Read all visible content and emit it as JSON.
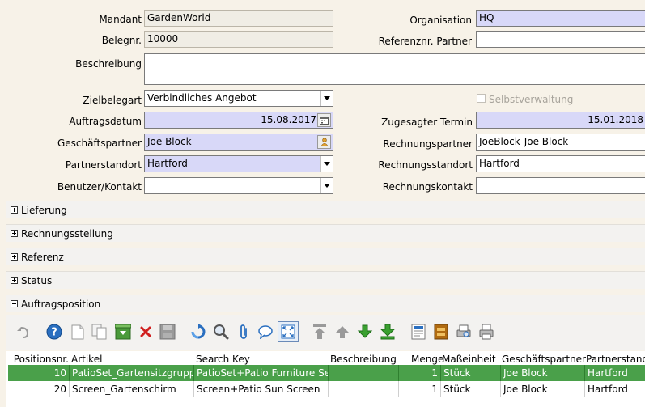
{
  "form": {
    "mandant": {
      "label": "Mandant",
      "value": "GardenWorld"
    },
    "organisation": {
      "label": "Organisation",
      "value": "HQ"
    },
    "belegnr": {
      "label": "Belegnr.",
      "value": "10000"
    },
    "referenznr": {
      "label": "Referenznr. Partner",
      "value": ""
    },
    "beschreibung": {
      "label": "Beschreibung",
      "value": ""
    },
    "zielbelegart": {
      "label": "Zielbelegart",
      "value": "Verbindliches Angebot"
    },
    "selbstverwaltung": {
      "label": "Selbstverwaltung",
      "checked": false
    },
    "auftragsdatum": {
      "label": "Auftragsdatum",
      "value": "15.08.2017"
    },
    "zugesagter_termin": {
      "label": "Zugesagter Termin",
      "value": "15.01.2018"
    },
    "geschaeftspartner": {
      "label": "Geschäftspartner",
      "value": "Joe Block"
    },
    "rechnungspartner": {
      "label": "Rechnungspartner",
      "value": "JoeBlock-Joe Block"
    },
    "partnerstandort": {
      "label": "Partnerstandort",
      "value": "Hartford"
    },
    "rechnungsstandort": {
      "label": "Rechnungsstandort",
      "value": "Hartford"
    },
    "benutzer": {
      "label": "Benutzer/Kontakt",
      "value": ""
    },
    "rechnungskontakt": {
      "label": "Rechnungskontakt",
      "value": ""
    }
  },
  "sections": [
    "Lieferung",
    "Rechnungsstellung",
    "Referenz",
    "Status",
    "Auftragsposition"
  ],
  "toolbar": {
    "icons": [
      "undo-icon",
      "help-icon",
      "new-record-icon",
      "copy-record-icon",
      "delete-selection-icon",
      "delete-icon",
      "save-icon",
      "refresh-icon",
      "find-icon",
      "attachment-icon",
      "chat-icon",
      "zoom-grid-icon",
      "parent-record-icon",
      "previous-record-icon",
      "next-record-icon",
      "last-record-icon",
      "report-icon",
      "archive-icon",
      "print-preview-icon",
      "print-icon"
    ]
  },
  "grid": {
    "headers": [
      "Positionsnr.",
      "Artikel",
      "Search Key",
      "Beschreibung",
      "Menge",
      "Maßeinheit",
      "Geschäftspartner",
      "Partnerstandort"
    ],
    "rows": [
      {
        "pos": "10",
        "artikel": "PatioSet_Gartensitzgruppe",
        "key": "PatioSet+Patio Furniture Set",
        "beschreibung": "",
        "menge": "1",
        "einheit": "Stück",
        "partner": "Joe Block",
        "standort": "Hartford",
        "selected": true
      },
      {
        "pos": "20",
        "artikel": "Screen_Gartenschirm",
        "key": "Screen+Patio Sun Screen",
        "beschreibung": "",
        "menge": "1",
        "einheit": "Stück",
        "partner": "Joe Block",
        "standort": "Hartford",
        "selected": false
      }
    ]
  },
  "colors": {
    "mandatory": "#d8d8f8",
    "selected_row": "#4aa04a",
    "background": "#f7f2e8"
  }
}
